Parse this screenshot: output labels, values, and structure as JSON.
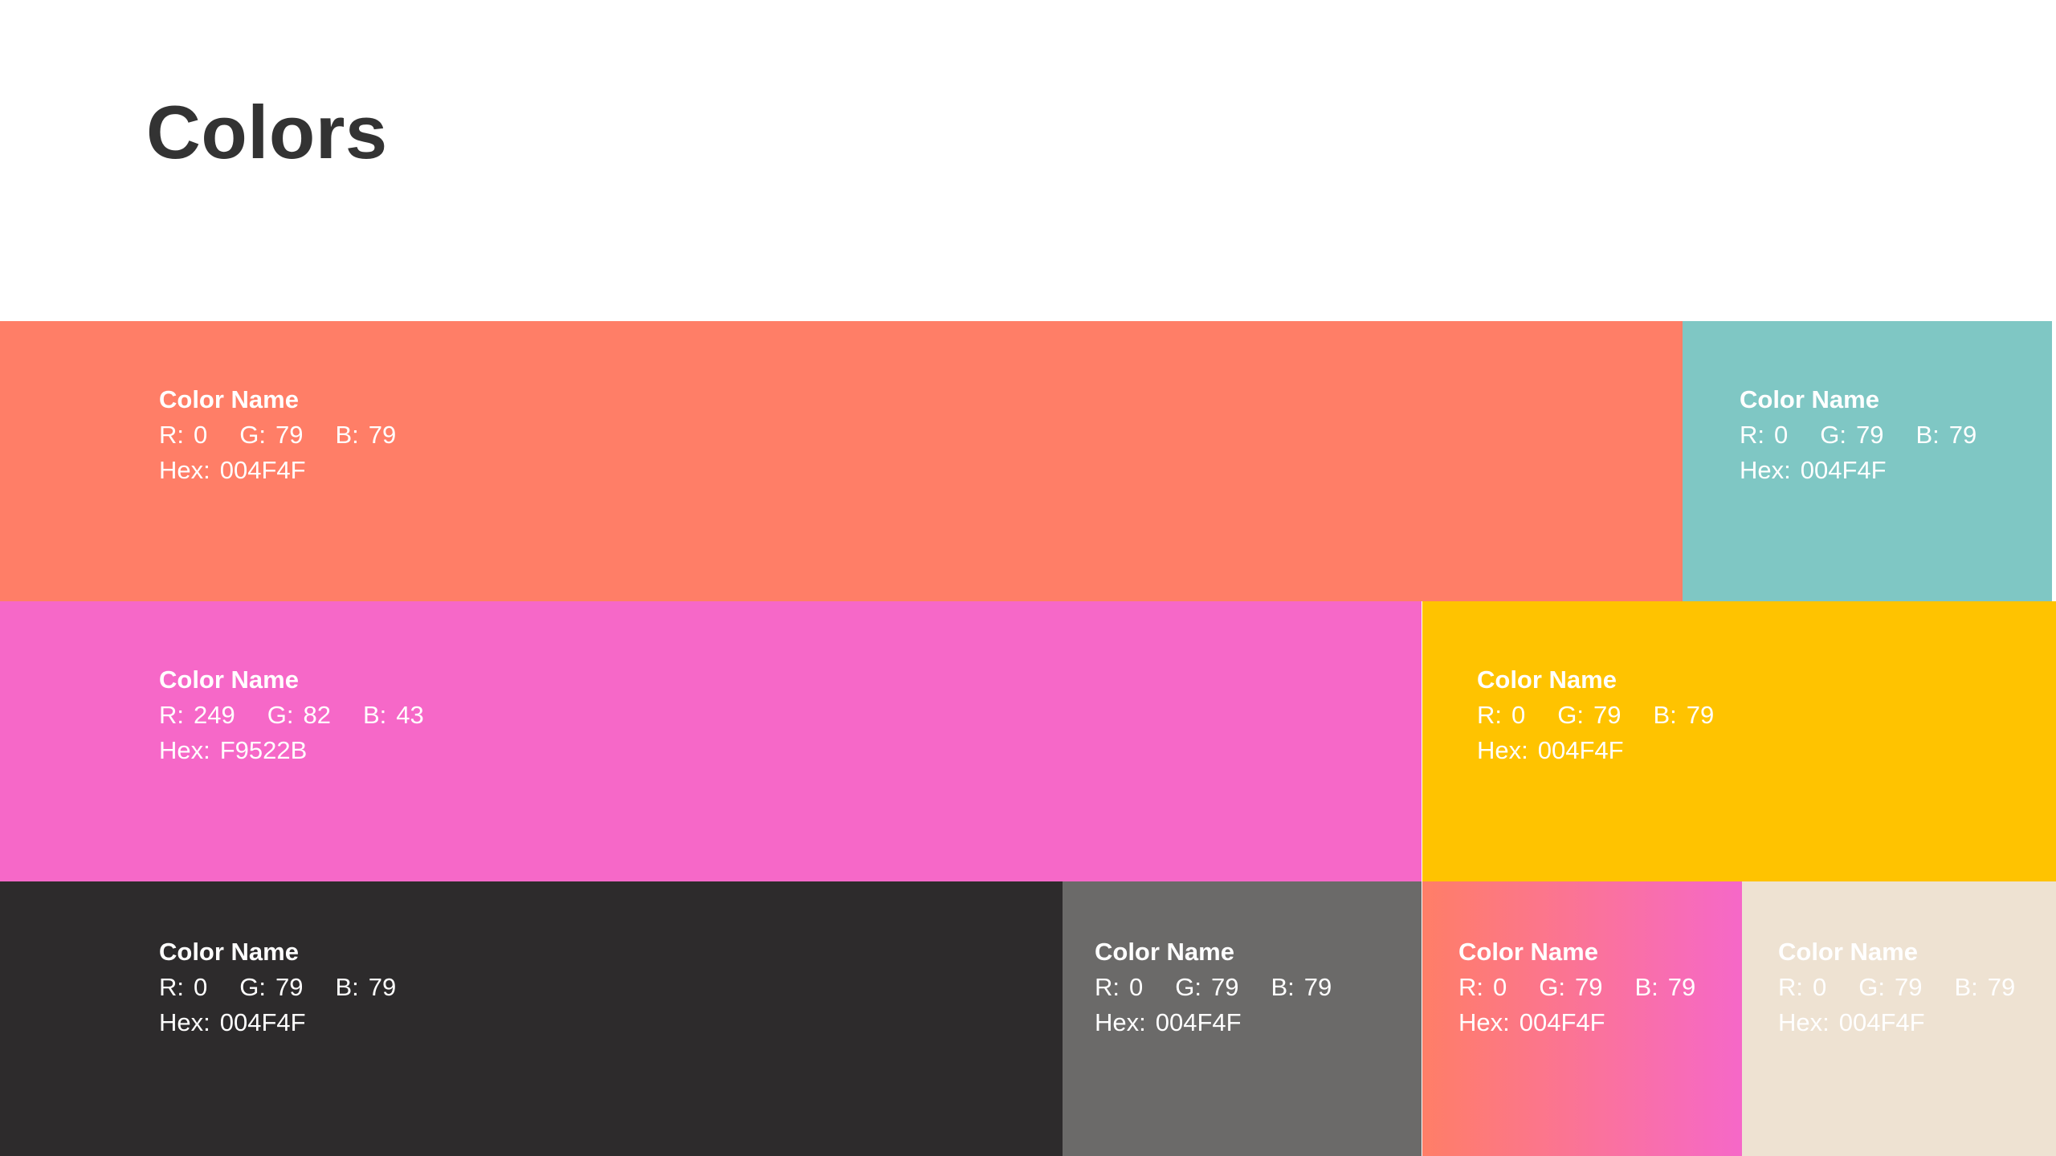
{
  "page": {
    "title": "Colors"
  },
  "swatches": [
    {
      "id": "coral",
      "color": "#ff7e67",
      "text_color": "#ffffff",
      "name": "Color Name",
      "r_label": "R:",
      "r": "0",
      "g_label": "G:",
      "g": "79",
      "b_label": "B:",
      "b": "79",
      "hex_label": "Hex:",
      "hex": "004F4F"
    },
    {
      "id": "teal",
      "color": "#7fc7c4",
      "text_color": "#ffffff",
      "name": "Color Name",
      "r_label": "R:",
      "r": "0",
      "g_label": "G:",
      "g": "79",
      "b_label": "B:",
      "b": "79",
      "hex_label": "Hex:",
      "hex": "004F4F"
    },
    {
      "id": "pink",
      "color": "#f668c8",
      "text_color": "#ffffff",
      "name": "Color Name",
      "r_label": "R:",
      "r": "249",
      "g_label": "G:",
      "g": "82",
      "b_label": "B:",
      "b": "43",
      "hex_label": "Hex:",
      "hex": "F9522B"
    },
    {
      "id": "yellow",
      "color": "#ffc300",
      "text_color": "#ffffff",
      "name": "Color Name",
      "r_label": "R:",
      "r": "0",
      "g_label": "G:",
      "g": "79",
      "b_label": "B:",
      "b": "79",
      "hex_label": "Hex:",
      "hex": "004F4F"
    },
    {
      "id": "dark",
      "color": "#2d2b2c",
      "text_color": "#ffffff",
      "name": "Color Name",
      "r_label": "R:",
      "r": "0",
      "g_label": "G:",
      "g": "79",
      "b_label": "B:",
      "b": "79",
      "hex_label": "Hex:",
      "hex": "004F4F"
    },
    {
      "id": "gray",
      "color": "#6b6a69",
      "text_color": "#ffffff",
      "name": "Color Name",
      "r_label": "R:",
      "r": "0",
      "g_label": "G:",
      "g": "79",
      "b_label": "B:",
      "b": "79",
      "hex_label": "Hex:",
      "hex": "004F4F"
    },
    {
      "id": "gradient",
      "color": "#ff7e67",
      "text_color": "#ffffff",
      "name": "Color Name",
      "r_label": "R:",
      "r": "0",
      "g_label": "G:",
      "g": "79",
      "b_label": "B:",
      "b": "79",
      "hex_label": "Hex:",
      "hex": "004F4F"
    },
    {
      "id": "beige",
      "color": "#eee2d2",
      "text_color": "#ffffff",
      "name": "Color Name",
      "r_label": "R:",
      "r": "0",
      "g_label": "G:",
      "g": "79",
      "b_label": "B:",
      "b": "79",
      "hex_label": "Hex:",
      "hex": "004F4F"
    }
  ]
}
